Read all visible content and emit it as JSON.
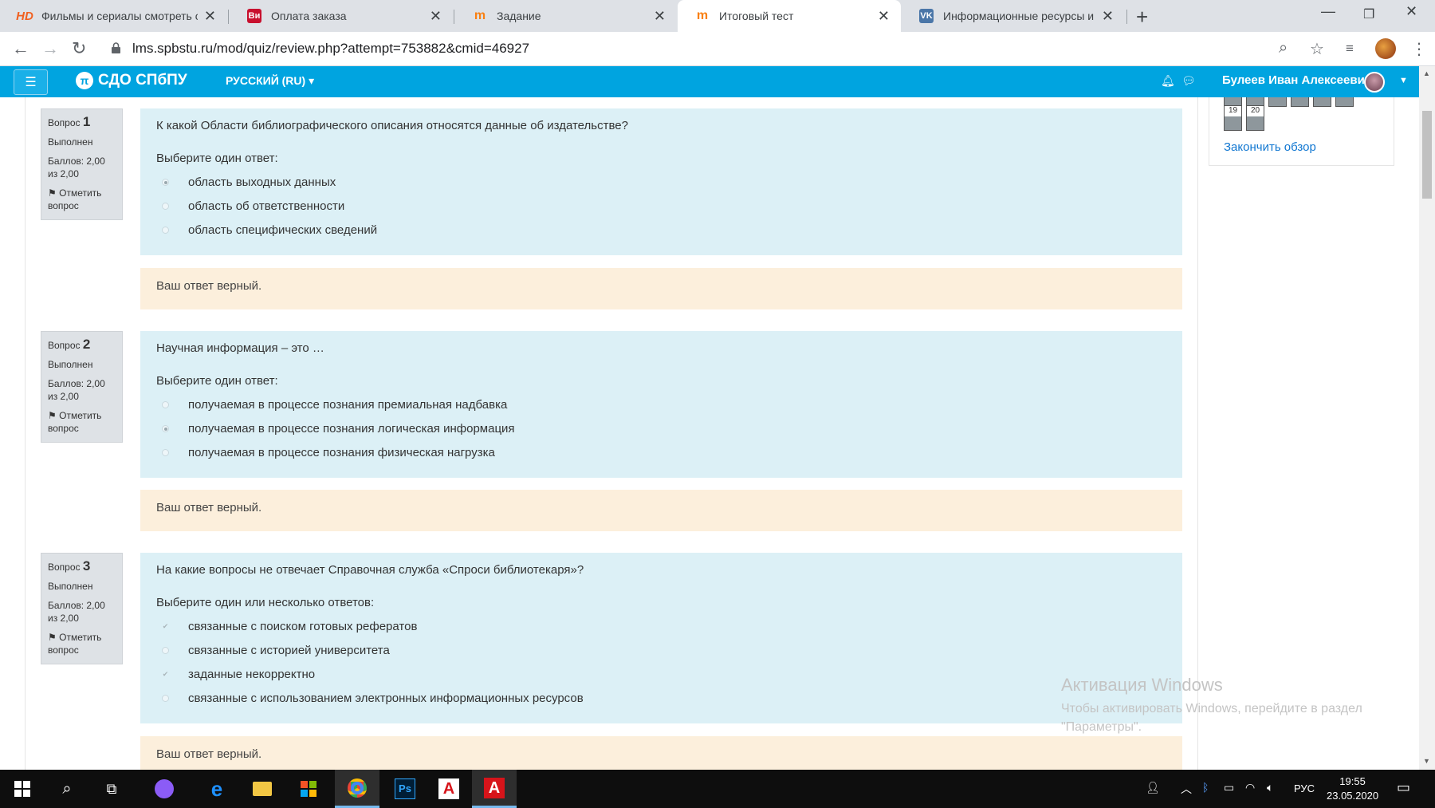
{
  "browser": {
    "tabs": [
      {
        "title": "Фильмы и сериалы смотреть он",
        "icon": "hd-icon"
      },
      {
        "title": "Оплата заказа",
        "icon": "vi-icon"
      },
      {
        "title": "Задание",
        "icon": "moodle-icon"
      },
      {
        "title": "Итоговый тест",
        "icon": "moodle-icon"
      },
      {
        "title": "Информационные ресурсы и те",
        "icon": "vk-icon"
      }
    ],
    "url": "lms.spbstu.ru/mod/quiz/review.php?attempt=753882&cmid=46927"
  },
  "navbar": {
    "brand": "СДО СПбПУ",
    "language": "РУССКИЙ (RU)",
    "user": "Булеев Иван Алексеевич"
  },
  "questions": [
    {
      "label": "Вопрос",
      "number": "1",
      "state": "Выполнен",
      "grade": "Баллов: 2,00 из 2,00",
      "flag": "Отметить вопрос",
      "text": "К какой Области библиографического описания относятся данные об издательстве?",
      "prompt": "Выберите один ответ:",
      "multi": false,
      "options": [
        {
          "text": "область выходных данных",
          "checked": true
        },
        {
          "text": "область об ответственности",
          "checked": false
        },
        {
          "text": "область  специфических сведений",
          "checked": false
        }
      ],
      "feedback": "Ваш ответ верный."
    },
    {
      "label": "Вопрос",
      "number": "2",
      "state": "Выполнен",
      "grade": "Баллов: 2,00 из 2,00",
      "flag": "Отметить вопрос",
      "text": "Научная информация – это …",
      "prompt": "Выберите один ответ:",
      "multi": false,
      "options": [
        {
          "text": "получаемая в процессе познания премиальная надбавка",
          "checked": false
        },
        {
          "text": "получаемая в процессе познания логическая информация",
          "checked": true
        },
        {
          "text": "получаемая в процессе познания физическая нагрузка",
          "checked": false
        }
      ],
      "feedback": "Ваш ответ верный."
    },
    {
      "label": "Вопрос",
      "number": "3",
      "state": "Выполнен",
      "grade": "Баллов: 2,00 из 2,00",
      "flag": "Отметить вопрос",
      "text": "На какие вопросы не отвечает Справочная служба «Спроси библиотекаря»?",
      "prompt": "Выберите один или несколько ответов:",
      "multi": true,
      "options": [
        {
          "text": "связанные с поиском готовых рефератов",
          "checked": true
        },
        {
          "text": "связанные с историей университета",
          "checked": false
        },
        {
          "text": "заданные некорректно",
          "checked": true
        },
        {
          "text": "связанные с использованием электронных информационных ресурсов",
          "checked": false
        }
      ],
      "feedback": "Ваш ответ верный."
    }
  ],
  "quiz_nav": {
    "buttons": [
      "19",
      "20"
    ],
    "finish": "Закончить обзор"
  },
  "watermark": {
    "title": "Активация Windows",
    "text": "Чтобы активировать Windows, перейдите в раздел \"Параметры\"."
  },
  "taskbar": {
    "lang": "РУС",
    "time": "19:55",
    "date": "23.05.2020"
  }
}
